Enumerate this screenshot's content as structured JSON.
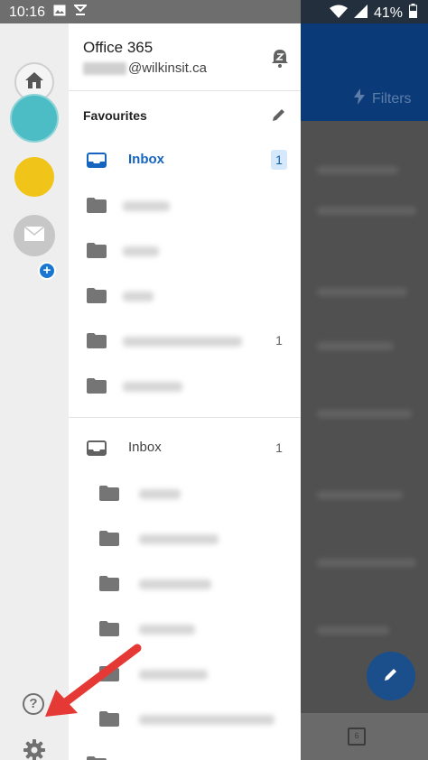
{
  "status_bar": {
    "time": "10:16",
    "battery": "41%",
    "icons": [
      "image-icon",
      "download-icon",
      "wifi-icon",
      "signal-icon",
      "battery-icon"
    ]
  },
  "background": {
    "filters_label": "Filters",
    "calendar_day": "6"
  },
  "rail": {
    "accounts": [
      "home-account",
      "teal-account",
      "yellow-account",
      "add-mail-account"
    ],
    "help_label": "?"
  },
  "drawer": {
    "account_name": "Office 365",
    "account_email": "@wilkinsit.ca",
    "favourites_title": "Favourites",
    "favourites": [
      {
        "label": "Inbox",
        "count": "1",
        "active": true
      },
      {
        "label": "",
        "count": ""
      },
      {
        "label": "",
        "count": ""
      },
      {
        "label": "",
        "count": ""
      },
      {
        "label": "",
        "count": "1"
      },
      {
        "label": "",
        "count": ""
      }
    ],
    "folders": [
      {
        "label": "Inbox",
        "count": "1"
      },
      {
        "label": "",
        "count": ""
      },
      {
        "label": "",
        "count": ""
      },
      {
        "label": "",
        "count": ""
      },
      {
        "label": "",
        "count": ""
      },
      {
        "label": "",
        "count": ""
      },
      {
        "label": "",
        "count": ""
      }
    ]
  },
  "colors": {
    "accent": "#1565c0",
    "header_blue": "#0a3a78",
    "teal_account": "#4cbdc4",
    "yellow_account": "#f0c419",
    "arrow_red": "#e53935"
  }
}
